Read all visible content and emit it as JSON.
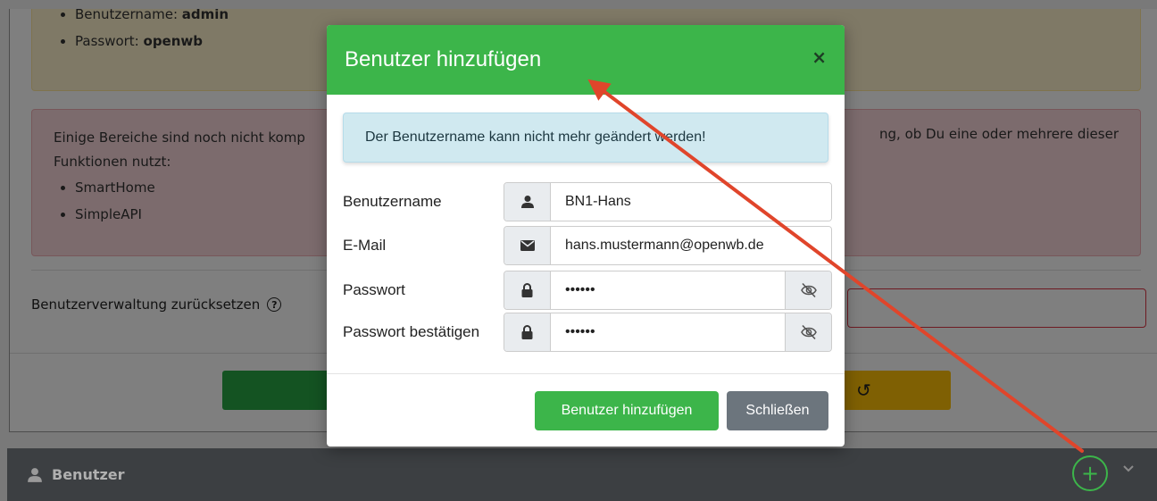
{
  "background": {
    "yellow_card": {
      "items": [
        {
          "label": "Benutzername: ",
          "value": "admin"
        },
        {
          "label": "Passwort: ",
          "value": "openwb"
        }
      ]
    },
    "red_card": {
      "text": "Einige Bereiche sind noch nicht komp",
      "text_cont": "Funktionen nutzt:",
      "text_right": "ng, ob Du eine oder mehrere dieser",
      "items": [
        "SmartHome",
        "SimpleAPI"
      ]
    },
    "reset_label": "Benutzerverwaltung zurücksetzen",
    "help_icon": "?"
  },
  "bottom_bar": {
    "title": "Benutzer",
    "add_icon": "+",
    "chevron_icon": "⌄"
  },
  "modal": {
    "title": "Benutzer hinzufügen",
    "close_icon": "×",
    "info": "Der Benutzername kann nicht mehr geändert werden!",
    "fields": [
      {
        "label": "Benutzername",
        "value": "BN1-Hans",
        "icon": "user-icon"
      },
      {
        "label": "E-Mail",
        "value": "hans.mustermann@openwb.de",
        "icon": "envelope-icon"
      },
      {
        "label": "Passwort",
        "value": "••••••",
        "icon": "lock-icon"
      },
      {
        "label": "Passwort bestätigen",
        "value": "••••••",
        "icon": "lock-icon"
      }
    ],
    "add_button": "Benutzer hinzufügen",
    "close_button": "Schließen"
  },
  "colors": {
    "accent_green": "#3cb54a",
    "secondary": "#6c757d",
    "annotation_arrow": "#e0452b"
  }
}
